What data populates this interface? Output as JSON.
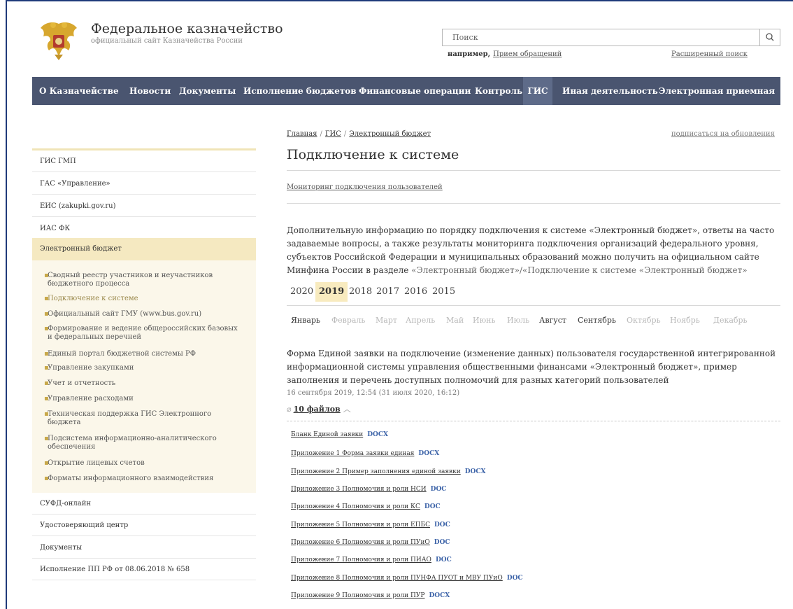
{
  "header": {
    "title": "Федеральное казначейство",
    "subtitle": "официальный сайт Казначейства России",
    "search_placeholder": "Поиск",
    "example_label": "например,",
    "example_link": "Прием обращений",
    "advanced_search": "Расширенный поиск"
  },
  "nav": [
    "О Казначействе",
    "Новости",
    "Документы",
    "Исполнение бюджетов",
    "Финансовые операции",
    "Контроль",
    "ГИС",
    "Иная деятельность",
    "Электронная приемная"
  ],
  "sidebar": {
    "items": [
      "ГИС ГМП",
      "ГАС «Управление»",
      "ЕИС (zakupki.gov.ru)",
      "ИАС ФК",
      "Электронный бюджет",
      "СУФД-онлайн",
      "Удостоверяющий центр",
      "Документы",
      "Исполнение ПП РФ от 08.06.2018 № 658"
    ],
    "sub_items": [
      "Сводный реестр участников и неучастников бюджетного процесса",
      "Подключение к системе",
      "Официальный сайт ГМУ (www.bus.gov.ru)",
      "Формирование и ведение общероссийских базовых и федеральных перечней",
      "Единый портал бюджетной системы РФ",
      "Управление закупками",
      "Учет и отчетность",
      "Управление расходами",
      "Техническая поддержка ГИС Электронного бюджета",
      "Подсистема информационно-аналитического обеспечения",
      "Открытие лицевых счетов",
      "Форматы информационного взаимодействия"
    ]
  },
  "breadcrumb": {
    "home": "Главная",
    "section": "ГИС",
    "current": "Электронный бюджет",
    "subscribe": "подписаться на обновления"
  },
  "main": {
    "title": "Подключение к системе",
    "monitor_link": "Мониторинг подключения пользователей",
    "intro_text": "Дополнительную информацию по порядку подключения к системе «Электронный бюджет», ответы на часто задаваемые вопросы, а также результаты мониторинга подключения организаций федерального уровня, субъектов Российской Федерации и муниципальных образований можно получить на официальном сайте Минфина России в разделе ",
    "intro_link": "«Электронный бюджет»/«Подключение к системе «Электронный бюджет»",
    "years": [
      "2020",
      "2019",
      "2018",
      "2017",
      "2016",
      "2015"
    ],
    "months_enabled": [
      "Январь",
      "Август",
      "Сентябрь"
    ],
    "months": [
      "Январь",
      "Февраль",
      "Март",
      "Апрель",
      "Май",
      "Июнь",
      "Июль",
      "Август",
      "Сентябрь",
      "Октябрь",
      "Ноябрь",
      "Декабрь"
    ],
    "doc_title": "Форма Единой заявки на подключение (изменение данных) пользователя государственной интегрированной информационной системы управления общественными финансами «Электронный бюджет», пример заполнения и перечень доступных полномочий для разных категорий пользователей",
    "doc_date": "16 сентября 2019, 12:54 (31 июля 2020, 16:12)",
    "files_label": "10 файлов",
    "files": [
      {
        "name": "Бланк Единой заявки",
        "ext": "DOCX"
      },
      {
        "name": "Приложение 1 Форма заявки единая",
        "ext": "DOCX"
      },
      {
        "name": "Приложение 2 Пример заполнения единой заявки",
        "ext": "DOCX"
      },
      {
        "name": "Приложение 3 Полномочия и роли НСИ",
        "ext": "DOC"
      },
      {
        "name": "Приложение 4 Полномочия и роли КС",
        "ext": "DOC"
      },
      {
        "name": "Приложение 5 Полномочия и роли ЕПБС",
        "ext": "DOC"
      },
      {
        "name": "Приложение 6 Полномочия и роли ПУиО",
        "ext": "DOC"
      },
      {
        "name": "Приложение 7 Полномочия и роли ПИАО",
        "ext": "DOC"
      },
      {
        "name": "Приложение 8 Полномочия и роли ПУНФА ПУОТ и МВУ ПУиО",
        "ext": "DOC"
      },
      {
        "name": "Приложение 9 Полномочия и роли ПУР",
        "ext": "DOCX"
      }
    ]
  },
  "colors": {
    "nav_bg": "#4a5570",
    "nav_active": "#5e6b89",
    "sidebar_active": "#f5e9c1",
    "sidebar_sub_bg": "#fbf7ea",
    "year_active": "#f8ebbf",
    "file_ext": "#3c63a8"
  }
}
